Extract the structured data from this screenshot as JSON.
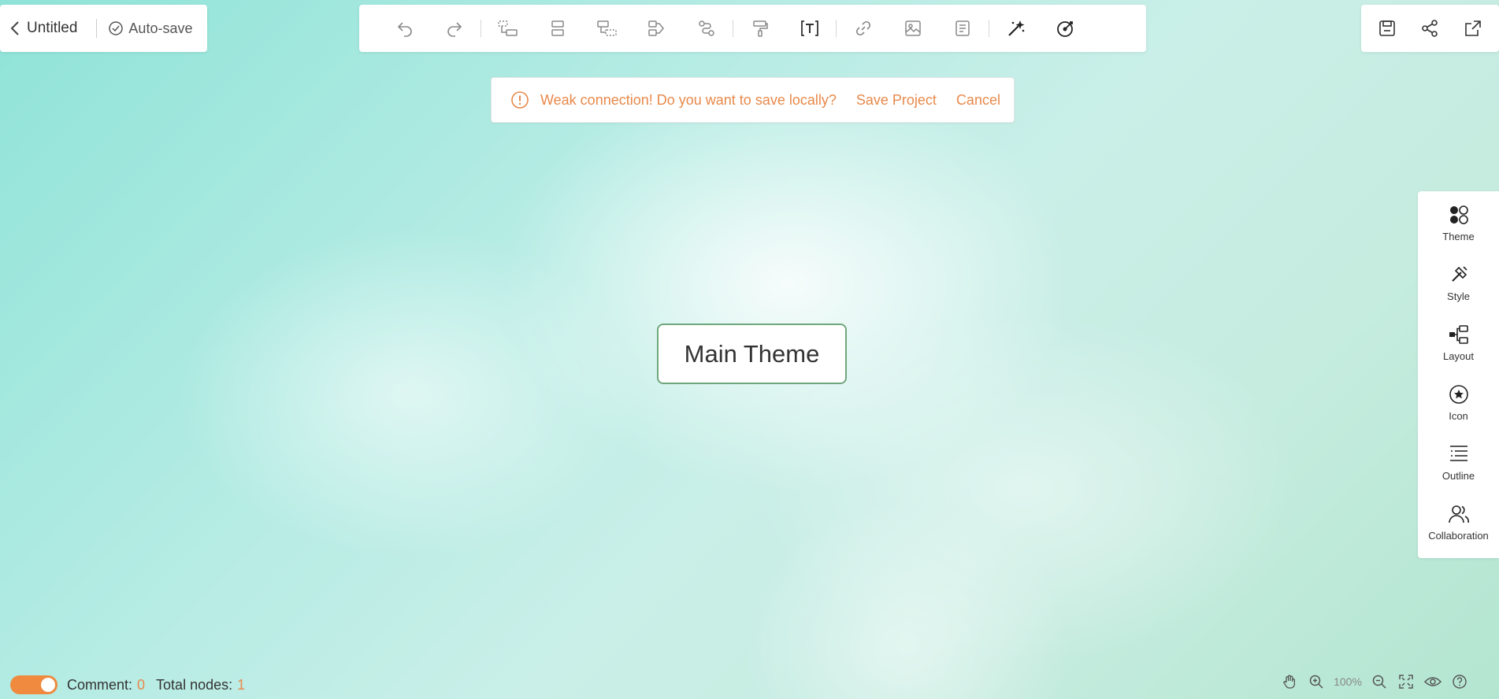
{
  "header": {
    "title": "Untitled",
    "autosave_label": "Auto-save"
  },
  "toolbar": {
    "items": [
      {
        "name": "undo-icon"
      },
      {
        "name": "redo-icon"
      },
      {
        "name": "add-child-node-icon"
      },
      {
        "name": "add-sibling-node-icon"
      },
      {
        "name": "add-parent-node-icon"
      },
      {
        "name": "add-relation-icon"
      },
      {
        "name": "add-connection-icon"
      },
      {
        "name": "format-painter-icon"
      },
      {
        "name": "text-icon"
      },
      {
        "name": "link-icon"
      },
      {
        "name": "image-icon"
      },
      {
        "name": "note-icon"
      },
      {
        "name": "ai-magic-icon"
      },
      {
        "name": "focus-target-icon"
      }
    ]
  },
  "top_right": {
    "items": [
      {
        "name": "save-icon"
      },
      {
        "name": "share-icon"
      },
      {
        "name": "export-icon"
      }
    ]
  },
  "warning": {
    "message": "Weak connection! Do you want to save locally?",
    "save_label": "Save Project",
    "cancel_label": "Cancel",
    "color": "#e8894a"
  },
  "canvas": {
    "main_node_label": "Main Theme"
  },
  "right_panel": {
    "items": [
      {
        "label": "Theme",
        "icon": "theme-icon"
      },
      {
        "label": "Style",
        "icon": "style-icon"
      },
      {
        "label": "Layout",
        "icon": "layout-icon"
      },
      {
        "label": "Icon",
        "icon": "icon-icon"
      },
      {
        "label": "Outline",
        "icon": "outline-icon"
      },
      {
        "label": "Collaboration",
        "icon": "collaboration-icon"
      }
    ]
  },
  "footer": {
    "comment_label": "Comment:",
    "comment_count": "0",
    "nodes_label": "Total nodes:",
    "nodes_count": "1",
    "zoom_level": "100%",
    "toggle_on": true,
    "accent_color": "#ef8a3f"
  }
}
